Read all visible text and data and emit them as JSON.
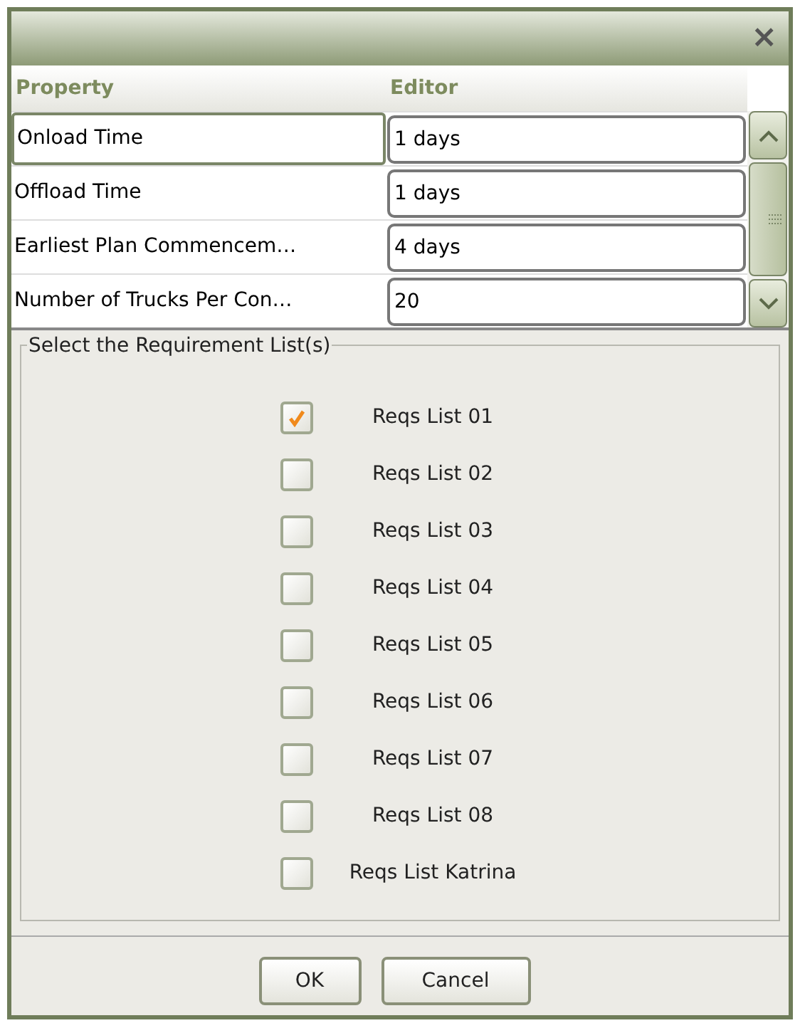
{
  "window": {
    "close": "×"
  },
  "table": {
    "columns": [
      "Property",
      "Editor"
    ],
    "rows": [
      {
        "property": "Onload Time",
        "editor": "1 days",
        "selected": true
      },
      {
        "property": "Offload Time",
        "editor": "1 days",
        "selected": false
      },
      {
        "property": "Earliest Plan Commencem…",
        "editor": "4 days",
        "selected": false
      },
      {
        "property": "Number of Trucks Per Con…",
        "editor": "20",
        "selected": false
      }
    ]
  },
  "group": {
    "title": "Select the Requirement List(s)",
    "items": [
      {
        "label": "Reqs List 01",
        "checked": true
      },
      {
        "label": "Reqs List 02",
        "checked": false
      },
      {
        "label": "Reqs List 03",
        "checked": false
      },
      {
        "label": "Reqs List 04",
        "checked": false
      },
      {
        "label": "Reqs List 05",
        "checked": false
      },
      {
        "label": "Reqs List 06",
        "checked": false
      },
      {
        "label": "Reqs List 07",
        "checked": false
      },
      {
        "label": "Reqs List 08",
        "checked": false
      },
      {
        "label": "Reqs List Katrina",
        "checked": false
      }
    ]
  },
  "buttons": [
    "OK",
    "Cancel"
  ]
}
